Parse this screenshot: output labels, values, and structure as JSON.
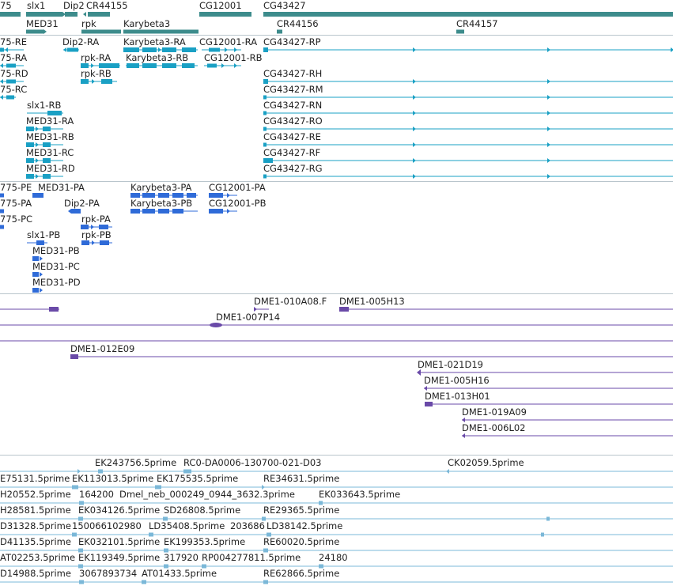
{
  "colors": {
    "gene": "#3d8c8c",
    "transcript": "#1aa0c4",
    "transcript_alt": "#2f6bd8",
    "clone": "#6a4aa8",
    "est": "#7bb8d8",
    "separator": "#b9c5cc"
  },
  "tracks": {
    "genes": {
      "labels": [
        "75",
        "slx1",
        "Dip2",
        "CR44155",
        "CG12001",
        "CG43427",
        "MED31",
        "rpk",
        "Karybeta3",
        "CR44156",
        "CR44157"
      ]
    },
    "transcripts_a": {
      "labels": [
        "75-RE",
        "Dip2-RA",
        "Karybeta3-RA",
        "CG12001-RA",
        "CG43427-RP",
        "75-RA",
        "rpk-RA",
        "Karybeta3-RB",
        "CG12001-RB",
        "75-RD",
        "rpk-RB",
        "CG43427-RH",
        "75-RC",
        "CG43427-RM",
        "slx1-RB",
        "CG43427-RN",
        "MED31-RA",
        "CG43427-RO",
        "MED31-RB",
        "CG43427-RE",
        "MED31-RC",
        "CG43427-RF",
        "MED31-RD",
        "CG43427-RG"
      ]
    },
    "transcripts_b": {
      "labels": [
        "775-PE",
        "MED31-PA",
        "Karybeta3-PA",
        "CG12001-PA",
        "775-PA",
        "Dip2-PA",
        "Karybeta3-PB",
        "CG12001-PB",
        "775-PC",
        "rpk-PA",
        "slx1-PB",
        "rpk-PB",
        "MED31-PB",
        "MED31-PC",
        "MED31-PD"
      ]
    },
    "clones": {
      "labels": [
        "DME1-010A08.F",
        "DME1-005H13",
        "DME1-007P14",
        "DME1-012E09",
        "DME1-021D19",
        "DME1-005H16",
        "DME1-013H01",
        "DME1-019A09",
        "DME1-006L02"
      ]
    },
    "ests": {
      "labels": [
        "EK243756.5prime",
        "RC0-DA0006-130700-021-D03",
        "CK02059.5prime",
        "E75131.5prime",
        "EK113013.5prime",
        "EK175535.5prime",
        "RE34631.5prime",
        "H20552.5prime",
        "164200",
        "Dmel_neb_000249_0944_3632.3prime",
        "EK033643.5prime",
        "H28581.5prime",
        "EK034126.5prime",
        "SD26808.5prime",
        "RE29365.5prime",
        "D31328.5prime",
        "150066102980",
        "LD35408.5prime",
        "203686",
        "LD38142.5prime",
        "D41135.5prime",
        "EK032101.5prime",
        "EK199353.5prime",
        "RE60020.5prime",
        "AT02253.5prime",
        "EK119349.5prime",
        "317920",
        "RP004277811.5prime",
        "24180",
        "D14988.5prime",
        "3067893734",
        "AT01433.5prime",
        "RE62866.5prime"
      ]
    }
  }
}
